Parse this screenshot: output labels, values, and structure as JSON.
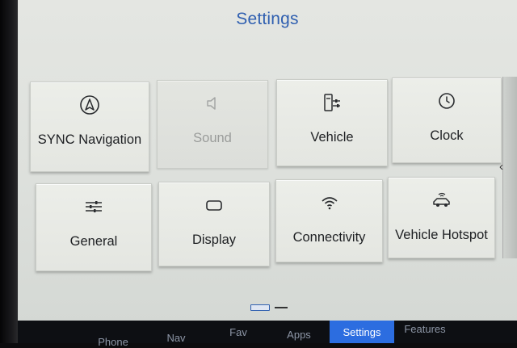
{
  "header": {
    "title": "Settings"
  },
  "tiles": [
    {
      "label": "SYNC Navigation",
      "icon": "navigation-arrow-icon",
      "enabled": true
    },
    {
      "label": "Sound",
      "icon": "speaker-icon",
      "enabled": false
    },
    {
      "label": "Vehicle",
      "icon": "vehicle-settings-icon",
      "enabled": true
    },
    {
      "label": "Clock",
      "icon": "clock-icon",
      "enabled": true
    },
    {
      "label": "General",
      "icon": "sliders-icon",
      "enabled": true
    },
    {
      "label": "Display",
      "icon": "display-icon",
      "enabled": true
    },
    {
      "label": "Connectivity",
      "icon": "wifi-icon",
      "enabled": true
    },
    {
      "label": "Vehicle Hotspot",
      "icon": "car-hotspot-icon",
      "enabled": true
    }
  ],
  "pager": {
    "current_page": 1,
    "total_pages": 2
  },
  "navbar": {
    "items": [
      "Phone",
      "Nav",
      "Fav",
      "Apps",
      "Settings",
      "Features"
    ],
    "active": "Settings"
  },
  "colors": {
    "accent": "#2f5fb0",
    "nav_active": "#2c6de0",
    "navbar_bg": "#0d0f13"
  }
}
